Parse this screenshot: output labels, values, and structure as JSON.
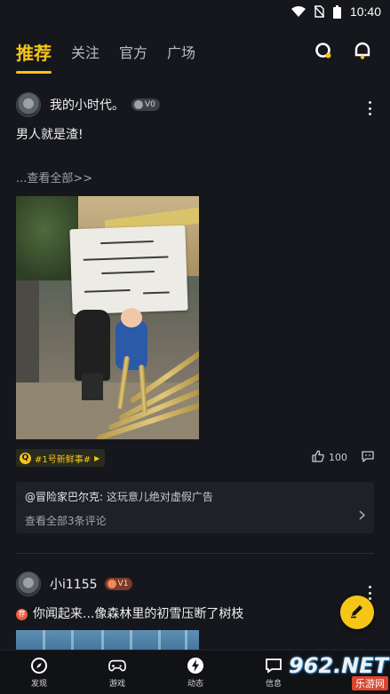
{
  "status_bar": {
    "time": "10:40"
  },
  "tabs": [
    {
      "label": "推荐",
      "active": true
    },
    {
      "label": "关注",
      "active": false
    },
    {
      "label": "官方",
      "active": false
    },
    {
      "label": "广场",
      "active": false
    }
  ],
  "accent_color": "#f5c518",
  "posts": [
    {
      "author": "我的小时代。",
      "level": "V0",
      "text": "男人就是渣!",
      "see_all": "...查看全部>>",
      "topic": "#1号新鲜事#",
      "likes": "100",
      "comment_first_user": "@冒险家巴尔克:",
      "comment_first_text": "这玩意儿绝对虚假广告",
      "comment_all": "查看全部3条评论"
    },
    {
      "author": "小i1155",
      "level": "V1",
      "hot_badge": "荐",
      "text": "你闻起来...像森林里的初雪压断了树枝"
    }
  ],
  "bottom_nav": [
    {
      "label": "发现",
      "icon": "compass-icon"
    },
    {
      "label": "游戏",
      "icon": "gamepad-icon"
    },
    {
      "label": "动态",
      "icon": "bolt-icon"
    },
    {
      "label": "信息",
      "icon": "message-icon"
    }
  ],
  "watermark": {
    "brand": "962.NET",
    "sub": "乐游网"
  }
}
